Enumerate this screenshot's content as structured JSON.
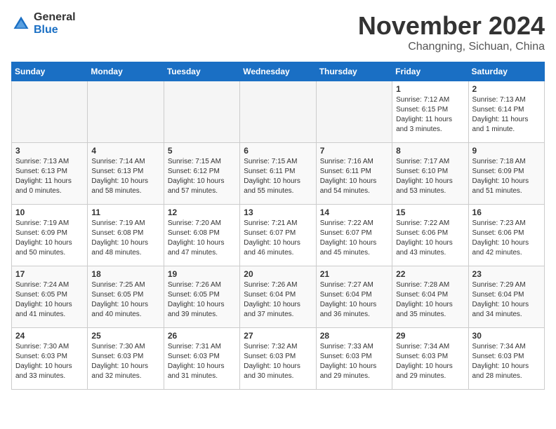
{
  "logo": {
    "text_general": "General",
    "text_blue": "Blue",
    "tagline": "GeneralBlue"
  },
  "title": "November 2024",
  "location": "Changning, Sichuan, China",
  "weekdays": [
    "Sunday",
    "Monday",
    "Tuesday",
    "Wednesday",
    "Thursday",
    "Friday",
    "Saturday"
  ],
  "weeks": [
    [
      {
        "day": "",
        "info": "",
        "empty": true
      },
      {
        "day": "",
        "info": "",
        "empty": true
      },
      {
        "day": "",
        "info": "",
        "empty": true
      },
      {
        "day": "",
        "info": "",
        "empty": true
      },
      {
        "day": "",
        "info": "",
        "empty": true
      },
      {
        "day": "1",
        "info": "Sunrise: 7:12 AM\nSunset: 6:15 PM\nDaylight: 11 hours\nand 3 minutes.",
        "empty": false
      },
      {
        "day": "2",
        "info": "Sunrise: 7:13 AM\nSunset: 6:14 PM\nDaylight: 11 hours\nand 1 minute.",
        "empty": false
      }
    ],
    [
      {
        "day": "3",
        "info": "Sunrise: 7:13 AM\nSunset: 6:13 PM\nDaylight: 11 hours\nand 0 minutes.",
        "empty": false
      },
      {
        "day": "4",
        "info": "Sunrise: 7:14 AM\nSunset: 6:13 PM\nDaylight: 10 hours\nand 58 minutes.",
        "empty": false
      },
      {
        "day": "5",
        "info": "Sunrise: 7:15 AM\nSunset: 6:12 PM\nDaylight: 10 hours\nand 57 minutes.",
        "empty": false
      },
      {
        "day": "6",
        "info": "Sunrise: 7:15 AM\nSunset: 6:11 PM\nDaylight: 10 hours\nand 55 minutes.",
        "empty": false
      },
      {
        "day": "7",
        "info": "Sunrise: 7:16 AM\nSunset: 6:11 PM\nDaylight: 10 hours\nand 54 minutes.",
        "empty": false
      },
      {
        "day": "8",
        "info": "Sunrise: 7:17 AM\nSunset: 6:10 PM\nDaylight: 10 hours\nand 53 minutes.",
        "empty": false
      },
      {
        "day": "9",
        "info": "Sunrise: 7:18 AM\nSunset: 6:09 PM\nDaylight: 10 hours\nand 51 minutes.",
        "empty": false
      }
    ],
    [
      {
        "day": "10",
        "info": "Sunrise: 7:19 AM\nSunset: 6:09 PM\nDaylight: 10 hours\nand 50 minutes.",
        "empty": false
      },
      {
        "day": "11",
        "info": "Sunrise: 7:19 AM\nSunset: 6:08 PM\nDaylight: 10 hours\nand 48 minutes.",
        "empty": false
      },
      {
        "day": "12",
        "info": "Sunrise: 7:20 AM\nSunset: 6:08 PM\nDaylight: 10 hours\nand 47 minutes.",
        "empty": false
      },
      {
        "day": "13",
        "info": "Sunrise: 7:21 AM\nSunset: 6:07 PM\nDaylight: 10 hours\nand 46 minutes.",
        "empty": false
      },
      {
        "day": "14",
        "info": "Sunrise: 7:22 AM\nSunset: 6:07 PM\nDaylight: 10 hours\nand 45 minutes.",
        "empty": false
      },
      {
        "day": "15",
        "info": "Sunrise: 7:22 AM\nSunset: 6:06 PM\nDaylight: 10 hours\nand 43 minutes.",
        "empty": false
      },
      {
        "day": "16",
        "info": "Sunrise: 7:23 AM\nSunset: 6:06 PM\nDaylight: 10 hours\nand 42 minutes.",
        "empty": false
      }
    ],
    [
      {
        "day": "17",
        "info": "Sunrise: 7:24 AM\nSunset: 6:05 PM\nDaylight: 10 hours\nand 41 minutes.",
        "empty": false
      },
      {
        "day": "18",
        "info": "Sunrise: 7:25 AM\nSunset: 6:05 PM\nDaylight: 10 hours\nand 40 minutes.",
        "empty": false
      },
      {
        "day": "19",
        "info": "Sunrise: 7:26 AM\nSunset: 6:05 PM\nDaylight: 10 hours\nand 39 minutes.",
        "empty": false
      },
      {
        "day": "20",
        "info": "Sunrise: 7:26 AM\nSunset: 6:04 PM\nDaylight: 10 hours\nand 37 minutes.",
        "empty": false
      },
      {
        "day": "21",
        "info": "Sunrise: 7:27 AM\nSunset: 6:04 PM\nDaylight: 10 hours\nand 36 minutes.",
        "empty": false
      },
      {
        "day": "22",
        "info": "Sunrise: 7:28 AM\nSunset: 6:04 PM\nDaylight: 10 hours\nand 35 minutes.",
        "empty": false
      },
      {
        "day": "23",
        "info": "Sunrise: 7:29 AM\nSunset: 6:04 PM\nDaylight: 10 hours\nand 34 minutes.",
        "empty": false
      }
    ],
    [
      {
        "day": "24",
        "info": "Sunrise: 7:30 AM\nSunset: 6:03 PM\nDaylight: 10 hours\nand 33 minutes.",
        "empty": false
      },
      {
        "day": "25",
        "info": "Sunrise: 7:30 AM\nSunset: 6:03 PM\nDaylight: 10 hours\nand 32 minutes.",
        "empty": false
      },
      {
        "day": "26",
        "info": "Sunrise: 7:31 AM\nSunset: 6:03 PM\nDaylight: 10 hours\nand 31 minutes.",
        "empty": false
      },
      {
        "day": "27",
        "info": "Sunrise: 7:32 AM\nSunset: 6:03 PM\nDaylight: 10 hours\nand 30 minutes.",
        "empty": false
      },
      {
        "day": "28",
        "info": "Sunrise: 7:33 AM\nSunset: 6:03 PM\nDaylight: 10 hours\nand 29 minutes.",
        "empty": false
      },
      {
        "day": "29",
        "info": "Sunrise: 7:34 AM\nSunset: 6:03 PM\nDaylight: 10 hours\nand 29 minutes.",
        "empty": false
      },
      {
        "day": "30",
        "info": "Sunrise: 7:34 AM\nSunset: 6:03 PM\nDaylight: 10 hours\nand 28 minutes.",
        "empty": false
      }
    ]
  ]
}
